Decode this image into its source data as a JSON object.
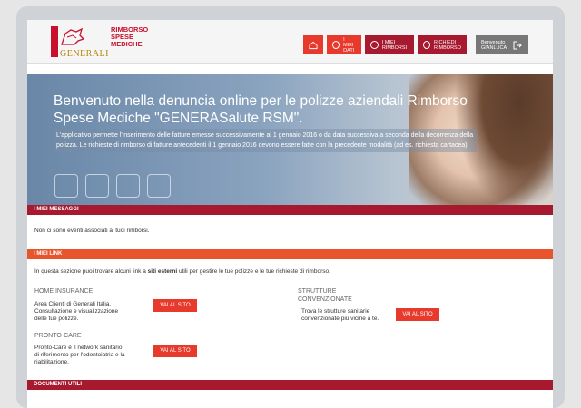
{
  "brand": {
    "rimborso_lines": [
      "RIMBORSO",
      "SPESE",
      "MEDICHE"
    ],
    "generali": "GENERALI"
  },
  "nav": {
    "miei_dati": "I MIEI DATI",
    "miei_rimborsi": "I MIEI RIMBORSI",
    "richiedi_rimborso": "RICHIEDI RIMBORSO",
    "user_greeting": "Benvenuto GIANLUCA"
  },
  "hero": {
    "title": "Benvenuto nella denuncia online per le polizze aziendali Rimborso Spese Mediche \"GENERASalute RSM\".",
    "intro": "L'applicativo permette l'inserimento delle fatture emesse successivamente al 1 gennaio 2016 o da data successiva a seconda della decorrenza della polizza. Le richieste di rimborso di fatture antecedenti il 1 gennaio 2016 devono essere fatte con la precedente modalità (ad es. richiesta cartacea)."
  },
  "messaggi": {
    "title": "I MIEI MESSAGGI",
    "empty": "Non ci sono eventi associati ai tuoi rimborsi."
  },
  "link": {
    "title": "I MIEI LINK",
    "intro_pre": "In questa sezione puoi trovare alcuni link a ",
    "intro_bold": "siti esterni",
    "intro_post": " utili per gestire le tue polizze e le tue richieste di rimborso.",
    "home_insurance": {
      "title": "HOME INSURANCE",
      "desc_lines": [
        "Area Clienti di Generali Italia.",
        "Consultazione e visualizzazione",
        "delle tue polizze."
      ],
      "button": "VAI AL SITO"
    },
    "strutture": {
      "title_lines": [
        "STRUTTURE",
        "CONVENZIONATE"
      ],
      "desc_lines": [
        "Trova le strutture sanitarie",
        "convenzionate più vicine a te."
      ],
      "button": "VAI AL SITO"
    },
    "pronto_care": {
      "title": "PRONTO-CARE",
      "desc_lines": [
        "Pronto-Care è il network sanitario",
        "di riferimento per l'odontoiatria e la",
        "riabilitazione."
      ],
      "button": "VAI AL SITO"
    }
  },
  "documenti": {
    "title": "DOCUMENTI UTILI"
  }
}
